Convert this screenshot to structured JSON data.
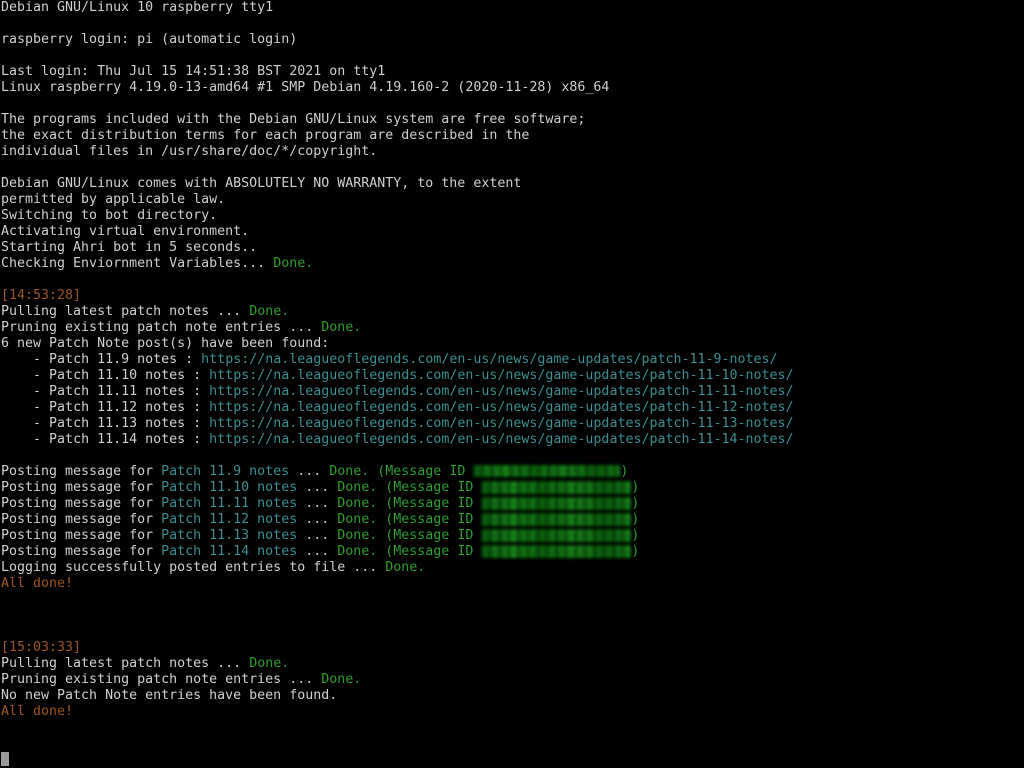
{
  "terminal": {
    "title": "Debian GNU/Linux 10 raspberry tty1",
    "colors": {
      "background": "#000000",
      "foreground": "#cfcfcf",
      "green": "#2f9c34",
      "teal": "#3c8d8d",
      "orange": "#9d5421",
      "cursor": "#9a9a9a",
      "redaction": "#18a81c"
    },
    "cursor": {
      "visible": true,
      "row": 47,
      "col": 0
    }
  },
  "boot": {
    "tty_banner": "Debian GNU/Linux 10 raspberry tty1",
    "login_prompt": "raspberry login: pi (automatic login)",
    "last_login": "Last login: Thu Jul 15 14:51:38 BST 2021 on tty1",
    "kernel": "Linux raspberry 4.19.0-13-amd64 #1 SMP Debian 4.19.160-2 (2020-11-28) x86_64",
    "motd_line1": "The programs included with the Debian GNU/Linux system are free software;",
    "motd_line2": "the exact distribution terms for each program are described in the",
    "motd_line3": "individual files in /usr/share/doc/*/copyright.",
    "warranty_line1": "Debian GNU/Linux comes with ABSOLUTELY NO WARRANTY, to the extent",
    "warranty_line2": "permitted by applicable law."
  },
  "startup": {
    "switching": "Switching to bot directory.",
    "activating": "Activating virtual environment.",
    "starting": "Starting Ahri bot in 5 seconds..",
    "checking_label": "Checking Enviornment Variables...",
    "checking_status": "Done."
  },
  "run1": {
    "timestamp": "[14:53:28]",
    "pulling_label": "Pulling latest patch notes ...",
    "pulling_status": "Done.",
    "pruning_label": "Pruning existing patch note entries ...",
    "pruning_status": "Done.",
    "found_header": "6 new Patch Note post(s) have been found:",
    "patches": [
      {
        "dash": "    - ",
        "name": "Patch 11.9 notes",
        "separator": " : ",
        "url": "https://na.leagueoflegends.com/en-us/news/game-updates/patch-11-9-notes/"
      },
      {
        "dash": "    - ",
        "name": "Patch 11.10 notes",
        "separator": " : ",
        "url": "https://na.leagueoflegends.com/en-us/news/game-updates/patch-11-10-notes/"
      },
      {
        "dash": "    - ",
        "name": "Patch 11.11 notes",
        "separator": " : ",
        "url": "https://na.leagueoflegends.com/en-us/news/game-updates/patch-11-11-notes/"
      },
      {
        "dash": "    - ",
        "name": "Patch 11.12 notes",
        "separator": " : ",
        "url": "https://na.leagueoflegends.com/en-us/news/game-updates/patch-11-12-notes/"
      },
      {
        "dash": "    - ",
        "name": "Patch 11.13 notes",
        "separator": " : ",
        "url": "https://na.leagueoflegends.com/en-us/news/game-updates/patch-11-13-notes/"
      },
      {
        "dash": "    - ",
        "name": "Patch 11.14 notes",
        "separator": " : ",
        "url": "https://na.leagueoflegends.com/en-us/news/game-updates/patch-11-14-notes/"
      }
    ],
    "posting": [
      {
        "prefix": "Posting message for ",
        "patch": "Patch 11.9 notes",
        "mid": " ... ",
        "status": "Done.",
        "id_open": " (Message ID ",
        "id_value": "[redacted]",
        "id_close": ")",
        "redact_width": 147
      },
      {
        "prefix": "Posting message for ",
        "patch": "Patch 11.10 notes",
        "mid": " ... ",
        "status": "Done.",
        "id_open": " (Message ID ",
        "id_value": "[redacted]",
        "id_close": ")",
        "redact_width": 150
      },
      {
        "prefix": "Posting message for ",
        "patch": "Patch 11.11 notes",
        "mid": " ... ",
        "status": "Done.",
        "id_open": " (Message ID ",
        "id_value": "[redacted]",
        "id_close": ")",
        "redact_width": 150
      },
      {
        "prefix": "Posting message for ",
        "patch": "Patch 11.12 notes",
        "mid": " ... ",
        "status": "Done.",
        "id_open": " (Message ID ",
        "id_value": "[redacted]",
        "id_close": ")",
        "redact_width": 150
      },
      {
        "prefix": "Posting message for ",
        "patch": "Patch 11.13 notes",
        "mid": " ... ",
        "status": "Done.",
        "id_open": " (Message ID ",
        "id_value": "[redacted]",
        "id_close": ")",
        "redact_width": 150
      },
      {
        "prefix": "Posting message for ",
        "patch": "Patch 11.14 notes",
        "mid": " ... ",
        "status": "Done.",
        "id_open": " (Message ID ",
        "id_value": "[redacted]",
        "id_close": ")",
        "redact_width": 150
      }
    ],
    "logging_label": "Logging successfully posted entries to file ...",
    "logging_status": "Done.",
    "all_done": "All done!"
  },
  "run2": {
    "timestamp": "[15:03:33]",
    "pulling_label": "Pulling latest patch notes ...",
    "pulling_status": "Done.",
    "pruning_label": "Pruning existing patch note entries ...",
    "pruning_status": "Done.",
    "no_new": "No new Patch Note entries have been found.",
    "all_done": "All done!"
  }
}
